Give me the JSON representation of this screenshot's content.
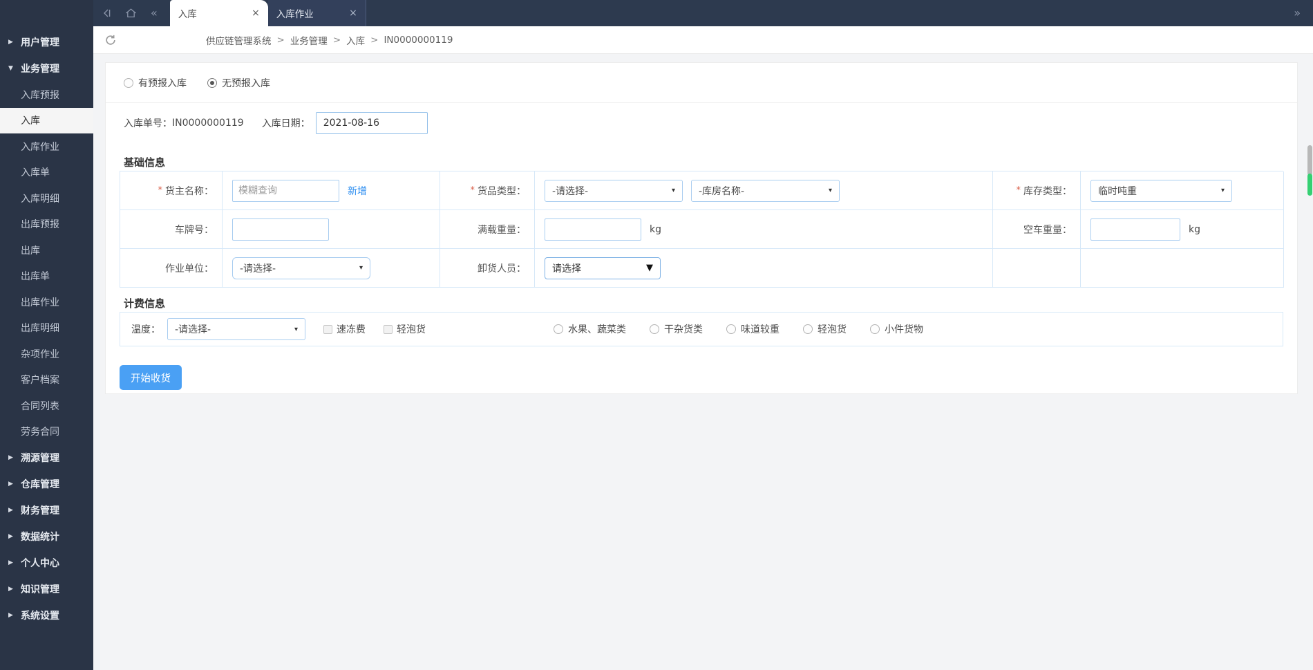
{
  "icons": {
    "expand": "▶",
    "collapse": "▼",
    "caret": "▾",
    "caret_bold": "▼",
    "close": "×",
    "collapse_left": "«",
    "expand_right": "»"
  },
  "topbar": {
    "tabs": [
      {
        "label": "入库",
        "active": true
      },
      {
        "label": "入库作业",
        "active": false
      }
    ]
  },
  "breadcrumb": {
    "sep": ">",
    "crumbs": [
      "供应链管理系统",
      "业务管理",
      "入库",
      "IN0000000119"
    ]
  },
  "sidebar": {
    "items": [
      {
        "label": "用户管理",
        "type": "group"
      },
      {
        "label": "业务管理",
        "type": "group-open"
      },
      {
        "label": "入库预报",
        "type": "sub"
      },
      {
        "label": "入库",
        "type": "sub",
        "active": true
      },
      {
        "label": "入库作业",
        "type": "sub"
      },
      {
        "label": "入库单",
        "type": "sub"
      },
      {
        "label": "入库明细",
        "type": "sub"
      },
      {
        "label": "出库预报",
        "type": "sub"
      },
      {
        "label": "出库",
        "type": "sub"
      },
      {
        "label": "出库单",
        "type": "sub"
      },
      {
        "label": "出库作业",
        "type": "sub"
      },
      {
        "label": "出库明细",
        "type": "sub"
      },
      {
        "label": "杂项作业",
        "type": "sub"
      },
      {
        "label": "客户档案",
        "type": "sub"
      },
      {
        "label": "合同列表",
        "type": "sub"
      },
      {
        "label": "劳务合同",
        "type": "sub"
      },
      {
        "label": "溯源管理",
        "type": "group"
      },
      {
        "label": "仓库管理",
        "type": "group"
      },
      {
        "label": "财务管理",
        "type": "group"
      },
      {
        "label": "数据统计",
        "type": "group"
      },
      {
        "label": "个人中心",
        "type": "group"
      },
      {
        "label": "知识管理",
        "type": "group"
      },
      {
        "label": "系统设置",
        "type": "group"
      }
    ]
  },
  "form": {
    "mode": {
      "options": [
        {
          "label": "有预报入库",
          "checked": false
        },
        {
          "label": "无预报入库",
          "checked": true
        }
      ]
    },
    "order": {
      "no_label": "入库单号：",
      "no_value": "IN0000000119",
      "date_label": "入库日期：",
      "date_value": "2021-08-16"
    },
    "sections": {
      "basic": "基础信息",
      "billing": "计费信息"
    },
    "basic": {
      "owner": {
        "label": "货主名称：",
        "required": "*",
        "placeholder": "模糊查询",
        "add_link": "新增"
      },
      "goods_type": {
        "label": "货品类型：",
        "required": "*",
        "select1": "-请选择-",
        "select2": "-库房名称-"
      },
      "stock_type": {
        "label": "库存类型：",
        "required": "*",
        "select": "临时吨重"
      },
      "plate": {
        "label": "车牌号："
      },
      "full_weight": {
        "label": "满载重量：",
        "unit": "kg"
      },
      "empty_weight": {
        "label": "空车重量：",
        "unit": "kg"
      },
      "work_unit": {
        "label": "作业单位：",
        "select": "-请选择-"
      },
      "unloader": {
        "label": "卸货人员：",
        "select": "请选择"
      }
    },
    "billing": {
      "temp_label": "温度：",
      "temp_select": "-请选择-",
      "checkboxes": [
        {
          "label": "速冻费",
          "checked": false
        },
        {
          "label": "轻泡货",
          "checked": false
        }
      ],
      "radios": [
        {
          "label": "水果、蔬菜类"
        },
        {
          "label": "干杂货类"
        },
        {
          "label": "味道较重"
        },
        {
          "label": "轻泡货"
        },
        {
          "label": "小件货物"
        }
      ]
    },
    "submit_label": "开始收货"
  },
  "colors": {
    "topbar_bg": "#2d3a4f",
    "sidebar_bg": "#2a3446",
    "table_border": "#d6e8f8",
    "accent_button": "#4aa0f4",
    "link": "#2a8cf0",
    "required": "#d9604a",
    "scrollbar_green": "#35d073"
  }
}
